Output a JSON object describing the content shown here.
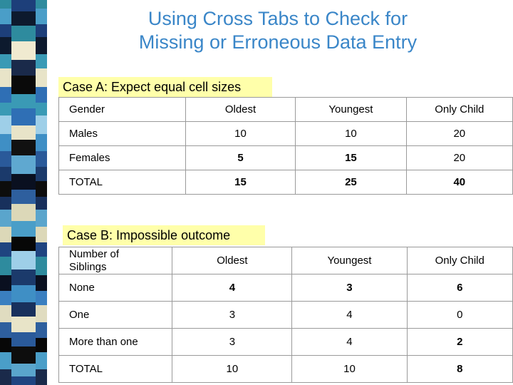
{
  "slide": {
    "title_line1": "Using Cross Tabs to Check for",
    "title_line2": "Missing or Erroneous Data Entry",
    "title_color": "#3a86c8",
    "highlight_color": "#ffffaa"
  },
  "case_a": {
    "caption": "Case A:  Expect equal cell sizes",
    "table": {
      "corner_header": "Gender",
      "columns": [
        "Oldest",
        "Youngest",
        "Only Child"
      ],
      "rows": [
        {
          "label": "Males",
          "values": [
            "10",
            "10",
            "20"
          ],
          "bold": false
        },
        {
          "label": "Females",
          "values": [
            "5",
            "15",
            "20"
          ],
          "bold": false
        },
        {
          "label": "TOTAL",
          "values": [
            "15",
            "25",
            "40"
          ],
          "bold": true
        }
      ]
    }
  },
  "case_b": {
    "caption": "Case B:  Impossible outcome",
    "table": {
      "corner_header_line1": "Number of",
      "corner_header_line2": "Siblings",
      "columns": [
        "Oldest",
        "Youngest",
        "Only Child"
      ],
      "rows": [
        {
          "label": "None",
          "values": [
            "4",
            "3",
            "6"
          ],
          "bold": false
        },
        {
          "label": "One",
          "values": [
            "3",
            "4",
            "0"
          ],
          "bold": false
        },
        {
          "label": "More than one",
          "values": [
            "3",
            "4",
            "2"
          ],
          "bold": false
        },
        {
          "label": "TOTAL",
          "values": [
            "10",
            "10",
            "8"
          ],
          "bold": false
        }
      ]
    }
  },
  "decor": {
    "stripe_colors_outer": [
      "#2e8b9e",
      "#f0ead0",
      "#1d3f7a",
      "#0d1a2e",
      "#3a9ab5",
      "#e8e4c8",
      "#2f6fb5",
      "#1a2a4a",
      "#5fa8d0",
      "#0a0a0a",
      "#3a7fc0",
      "#e0dcc0",
      "#2e5f9e",
      "#111111",
      "#4a9ec8",
      "#dcd8b8",
      "#1b3a6b",
      "#0a1020",
      "#9ecfe8",
      "#2a5a9a",
      "#0d0d0d",
      "#3f8fc5",
      "#e8e4c8",
      "#18305c",
      "#070707",
      "#5aa5cc",
      "#1f4480"
    ],
    "stripe_colors_inner": [
      "#1d3f7a",
      "#0d1a2e",
      "#2e8b9e",
      "#f0ead0",
      "#1a2a4a",
      "#0a0a0a",
      "#3a9ab5",
      "#2f6fb5",
      "#e8e4c8",
      "#111111",
      "#5fa8d0",
      "#0a1020",
      "#2e5f9e",
      "#dcd8b8",
      "#4a9ec8",
      "#070707",
      "#9ecfe8",
      "#1b3a6b",
      "#3f8fc5",
      "#18305c",
      "#e8e4c8",
      "#2a5a9a",
      "#0d0d0d",
      "#5aa5cc",
      "#1f4480"
    ]
  }
}
